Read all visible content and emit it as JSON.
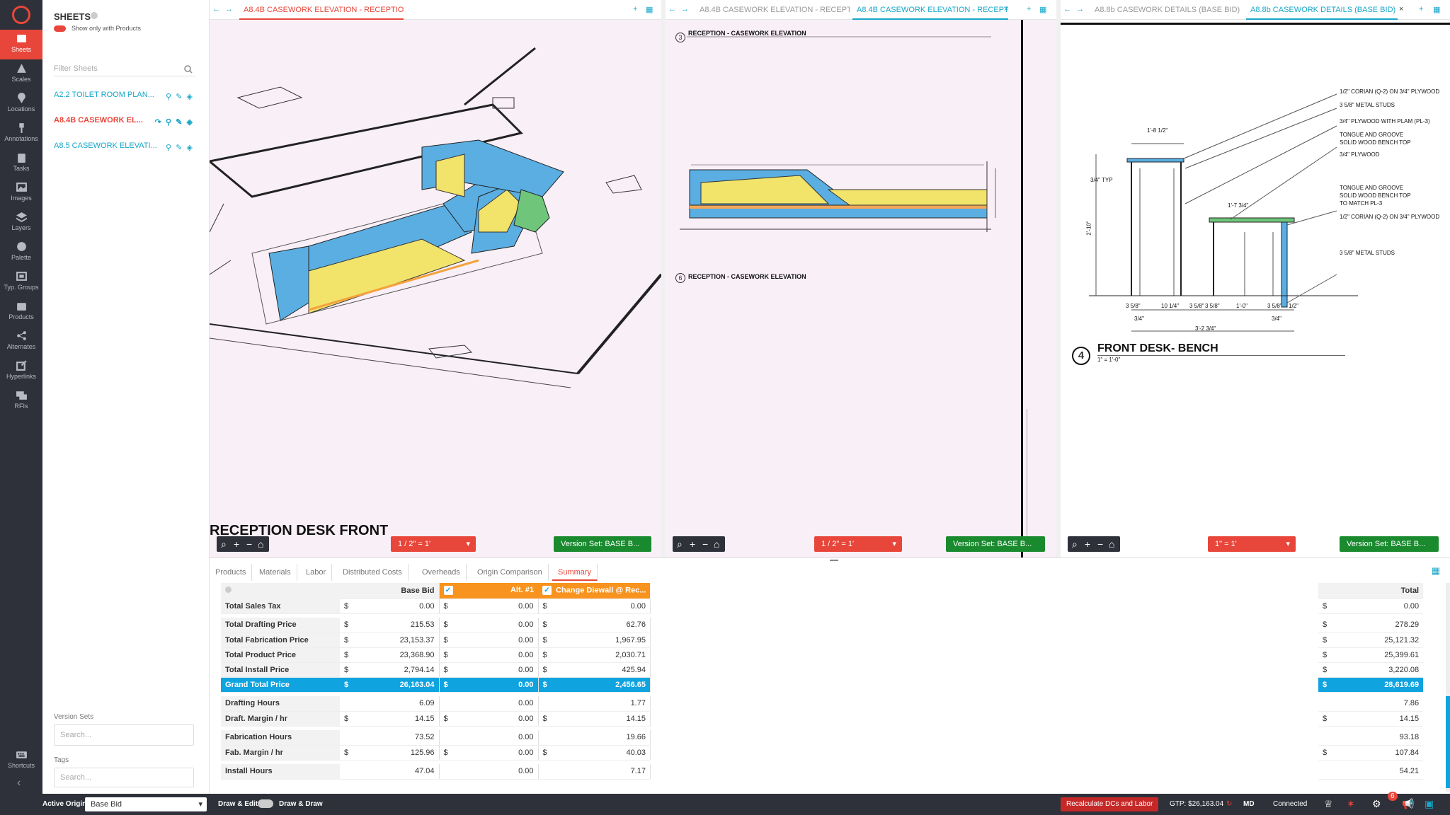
{
  "rail": {
    "items": [
      {
        "label": "Sheets",
        "icon": "map-icon"
      },
      {
        "label": "Scales",
        "icon": "scale-icon"
      },
      {
        "label": "Locations",
        "icon": "pin-icon"
      },
      {
        "label": "Annotations",
        "icon": "pushpin-icon"
      },
      {
        "label": "Tasks",
        "icon": "clipboard-icon"
      },
      {
        "label": "Images",
        "icon": "image-icon"
      },
      {
        "label": "Layers",
        "icon": "layers-icon"
      },
      {
        "label": "Palette",
        "icon": "palette-icon"
      },
      {
        "label": "Typ. Groups",
        "icon": "groups-icon"
      },
      {
        "label": "Products",
        "icon": "box-icon"
      },
      {
        "label": "Alternates",
        "icon": "share-icon"
      },
      {
        "label": "Hyperlinks",
        "icon": "external-link-icon"
      },
      {
        "label": "RFIs",
        "icon": "chat-icon"
      }
    ],
    "shortcuts_label": "Shortcuts"
  },
  "sheets_panel": {
    "title": "SHEETS",
    "toggle_label": "Show only with Products",
    "filter_placeholder": "Filter Sheets",
    "sheets": [
      {
        "name": "A2.2 TOILET ROOM PLAN..."
      },
      {
        "name": "A8.4B CASEWORK EL..."
      },
      {
        "name": "A8.5 CASEWORK ELEVATI..."
      }
    ],
    "version_sets_label": "Version Sets",
    "version_sets_placeholder": "Search...",
    "tags_label": "Tags",
    "tags_placeholder": "Search..."
  },
  "panes": [
    {
      "tabs": [
        "A8.4B CASEWORK ELEVATION - RECEPTIO..."
      ],
      "drawing_title": "RECEPTION DESK FRONT",
      "scale": "1 / 2\" = 1'",
      "version": "Version Set: BASE B..."
    },
    {
      "tabs": [
        "A8.4B CASEWORK ELEVATION - RECEPT...",
        "A8.4B CASEWORK ELEVATION - RECEPT"
      ],
      "callout_top_num": "3",
      "callout_top": "RECEPTION - CASEWORK ELEVATION",
      "callout_bottom_num": "6",
      "callout_bottom": "RECEPTION - CASEWORK ELEVATION",
      "scale": "1 / 2\" = 1'",
      "version": "Version Set: BASE B..."
    },
    {
      "tabs": [
        "A8.8b CASEWORK DETAILS (BASE BID)",
        "A8.8b CASEWORK DETAILS (BASE BID)"
      ],
      "detail_num": "4",
      "detail_title": "FRONT DESK- BENCH",
      "detail_scale": "1\" = 1'-0\"",
      "notes": [
        "1/2\" CORIAN (Q-2) ON 3/4\" PLYWOOD",
        "3 5/8\" METAL STUDS",
        "3/4\" PLYWOOD WITH PLAM (PL-3)",
        "TONGUE AND GROOVE",
        "SOLID WOOD BENCH TOP",
        "3/4\" PLYWOOD",
        "TONGUE AND GROOVE",
        "SOLID WOOD BENCH TOP",
        "TO MATCH PL-3",
        "1/2\" CORIAN (Q-2) ON 3/4\" PLYWOOD",
        "3 5/8\" METAL STUDS"
      ],
      "dims": [
        "1'-8 1/2\"",
        "3/4\" TYP",
        "2'-10\"",
        "1'-7 3/4\"",
        "3 5/8\"",
        "10 1/4\"",
        "3 5/8\"",
        "3 5/8\"",
        "1'-0\"",
        "3 5/8\"",
        "1/2\"",
        "3/4\"",
        "3'-2 3/4\"",
        "3/4\""
      ],
      "scale": "1\" = 1'",
      "version": "Version Set: BASE B..."
    }
  ],
  "bottom_tabs": [
    "Products",
    "Materials",
    "Labor",
    "Distributed Costs",
    "Overheads",
    "Origin Comparison",
    "Summary"
  ],
  "summary": {
    "columns": [
      "Base Bid",
      "Alt. #1",
      "Change Diewall @ Rec..."
    ],
    "total_label": "Total",
    "rows": [
      {
        "label": "Total Sales Tax",
        "cur": [
          "$",
          "$",
          "$"
        ],
        "vals": [
          "0.00",
          "0.00",
          "0.00"
        ],
        "total_cur": "$",
        "total": "0.00"
      },
      {
        "gap": true
      },
      {
        "label": "Total Drafting Price",
        "cur": [
          "$",
          "$",
          "$"
        ],
        "vals": [
          "215.53",
          "0.00",
          "62.76"
        ],
        "total_cur": "$",
        "total": "278.29"
      },
      {
        "label": "Total Fabrication Price",
        "cur": [
          "$",
          "$",
          "$"
        ],
        "vals": [
          "23,153.37",
          "0.00",
          "1,967.95"
        ],
        "total_cur": "$",
        "total": "25,121.32"
      },
      {
        "label": "Total Product Price",
        "cur": [
          "$",
          "$",
          "$"
        ],
        "vals": [
          "23,368.90",
          "0.00",
          "2,030.71"
        ],
        "total_cur": "$",
        "total": "25,399.61"
      },
      {
        "label": "Total Install Price",
        "cur": [
          "$",
          "$",
          "$"
        ],
        "vals": [
          "2,794.14",
          "0.00",
          "425.94"
        ],
        "total_cur": "$",
        "total": "3,220.08"
      },
      {
        "label": "Grand Total Price",
        "cur": [
          "$",
          "$",
          "$"
        ],
        "vals": [
          "26,163.04",
          "0.00",
          "2,456.65"
        ],
        "total_cur": "$",
        "total": "28,619.69",
        "grand": true
      },
      {
        "gap": true
      },
      {
        "label": "Drafting Hours",
        "cur": [
          "",
          "",
          ""
        ],
        "vals": [
          "6.09",
          "0.00",
          "1.77"
        ],
        "total_cur": "",
        "total": "7.86"
      },
      {
        "label": "Draft. Margin / hr",
        "cur": [
          "$",
          "$",
          "$"
        ],
        "vals": [
          "14.15",
          "0.00",
          "14.15"
        ],
        "total_cur": "$",
        "total": "14.15"
      },
      {
        "gap": true
      },
      {
        "label": "Fabrication Hours",
        "cur": [
          "",
          "",
          ""
        ],
        "vals": [
          "73.52",
          "0.00",
          "19.66"
        ],
        "total_cur": "",
        "total": "93.18"
      },
      {
        "label": "Fab. Margin / hr",
        "cur": [
          "$",
          "$",
          "$"
        ],
        "vals": [
          "125.96",
          "0.00",
          "40.03"
        ],
        "total_cur": "$",
        "total": "107.84"
      },
      {
        "gap": true
      },
      {
        "label": "Install Hours",
        "cur": [
          "",
          "",
          ""
        ],
        "vals": [
          "47.04",
          "0.00",
          "7.17"
        ],
        "total_cur": "",
        "total": "54.21"
      }
    ]
  },
  "status": {
    "active_origin_label": "Active Origin:",
    "active_origin_value": "Base Bid",
    "draw_edit_label": "Draw & Edit",
    "draw_draw_label": "Draw & Draw",
    "recalc_label": "Recalculate DCs and Labor",
    "gtp_label": "GTP: $26,163.04",
    "user_initials": "MD",
    "connection": "Connected",
    "notification_count": "6"
  },
  "colors": {
    "accent": "#e8463a",
    "link": "#17a6c8",
    "rail_bg": "#2e3139",
    "version_green": "#1a8a2e",
    "grand_total_blue": "#0fa3e0",
    "alt_header_orange": "#f7931e"
  }
}
